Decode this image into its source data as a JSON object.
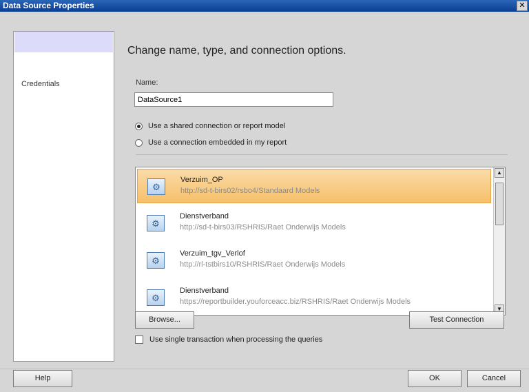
{
  "window": {
    "title": "Data Source Properties",
    "close_glyph": "✕"
  },
  "nav": {
    "items": [
      {
        "label": ""
      },
      {
        "label": "Credentials"
      }
    ]
  },
  "main": {
    "heading": "Change name, type, and connection options.",
    "name_label": "Name:",
    "name_value": "DataSource1",
    "radio_shared": "Use a shared connection or report model",
    "radio_embedded": "Use a connection embedded in my report",
    "selected_radio": "shared"
  },
  "list": {
    "items": [
      {
        "name": "Verzuim_OP",
        "url": "http://sd-t-birs02/rsbo4/Standaard Models",
        "selected": true,
        "icon": "report-model-icon"
      },
      {
        "name": "Dienstverband",
        "url": "http://sd-t-birs03/RSHRIS/Raet Onderwijs Models",
        "selected": false,
        "icon": "report-model-icon"
      },
      {
        "name": "Verzuim_tgv_Verlof",
        "url": "http://rl-tstbirs10/RSHRIS/Raet Onderwijs Models",
        "selected": false,
        "icon": "report-model-icon"
      },
      {
        "name": "Dienstverband",
        "url": "https://reportbuilder.youforceacc.biz/RSHRIS/Raet Onderwijs Models",
        "selected": false,
        "icon": "report-model-icon"
      }
    ]
  },
  "buttons": {
    "browse": "Browse...",
    "test_connection": "Test Connection",
    "help": "Help",
    "ok": "OK",
    "cancel": "Cancel"
  },
  "options": {
    "single_transaction": "Use single transaction when processing the queries",
    "single_transaction_checked": false
  },
  "colors": {
    "selection": "#f6c06a",
    "title_bar": "#0b3d91",
    "dialog_bg": "#d6d6d6"
  }
}
